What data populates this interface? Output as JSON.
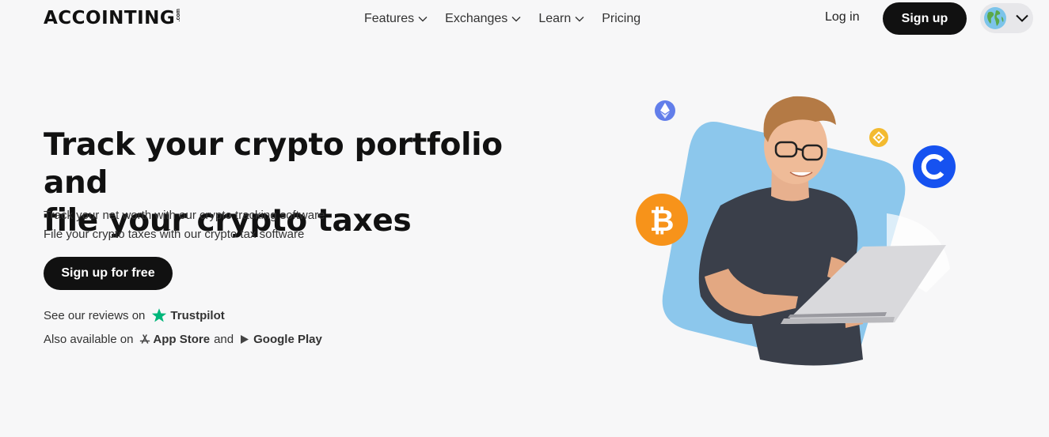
{
  "header": {
    "logo_text": "ACCOINTING",
    "logo_suffix": ".com",
    "nav": [
      {
        "label": "Features",
        "has_dropdown": true
      },
      {
        "label": "Exchanges",
        "has_dropdown": true
      },
      {
        "label": "Learn",
        "has_dropdown": true
      },
      {
        "label": "Pricing",
        "has_dropdown": false
      }
    ],
    "login_label": "Log in",
    "signup_label": "Sign up",
    "language_icon": "globe-icon"
  },
  "hero": {
    "title_line1": "Track your crypto portfolio and",
    "title_line2": "file your crypto taxes",
    "sub_line1": "Track your net worth with our crypto tracking software",
    "sub_line2": "File your crypto taxes with our crypto tax software",
    "cta_label": "Sign up for free",
    "reviews_prefix": "See our reviews on",
    "trustpilot_label": "Trustpilot",
    "available_prefix": "Also available on",
    "app_store_label": "App Store",
    "and_label": "and",
    "google_play_label": "Google Play"
  },
  "colors": {
    "background": "#f7f7f8",
    "button_dark": "#111111",
    "trustpilot_green": "#00b67a",
    "illustration_blue": "#8cc7ec",
    "bitcoin_orange": "#f7931a",
    "coinbase_blue": "#1652f0",
    "ethereum_purple": "#627eea",
    "bnb_yellow": "#f3ba2f"
  },
  "icons": [
    "ethereum-icon",
    "bnb-icon",
    "coinbase-icon",
    "bitcoin-icon",
    "trustpilot-star-icon",
    "apple-store-icon",
    "google-play-icon"
  ]
}
